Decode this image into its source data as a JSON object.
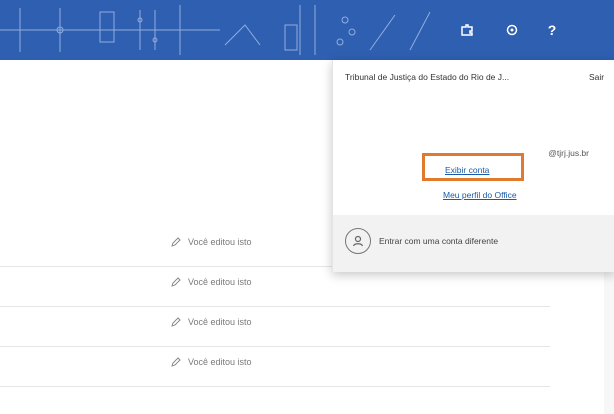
{
  "header": {
    "help_label": "?",
    "icons": [
      "puzzle-icon",
      "gear-icon",
      "help-icon"
    ]
  },
  "account_card": {
    "org_name": "Tribunal de Justiça do Estado do Rio de J...",
    "sign_out_label": "Sair",
    "email": "@tjrj.jus.br",
    "view_account_label": "Exibir conta",
    "office_profile_label": "Meu perfil do Office",
    "other_account_label": "Entrar com uma conta diferente",
    "highlight_color": "#e07a2f"
  },
  "rows": [
    {
      "activity": "Você editou isto"
    },
    {
      "activity": "Você editou isto"
    },
    {
      "activity": "Você editou isto"
    },
    {
      "activity": "Você editou isto"
    }
  ]
}
